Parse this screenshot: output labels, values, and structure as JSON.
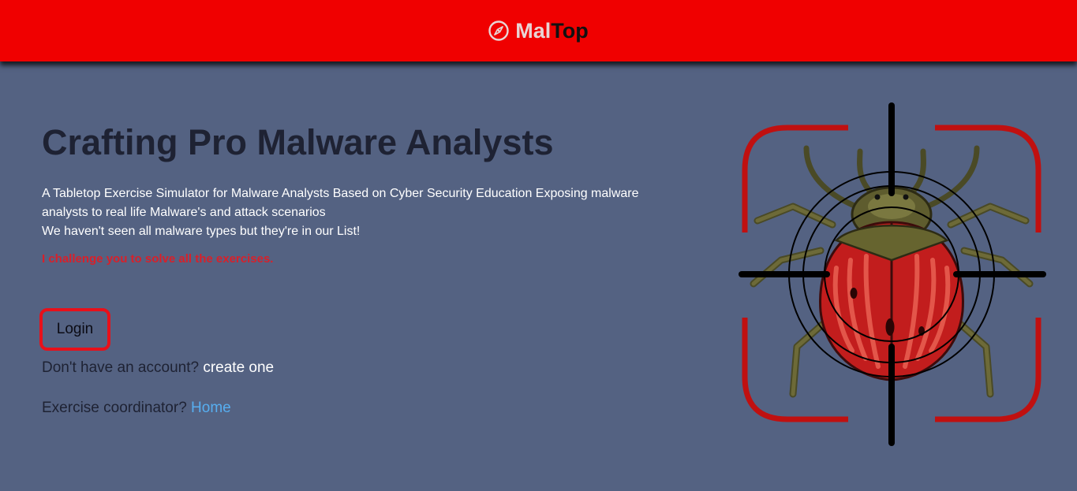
{
  "navbar": {
    "brand_part1": "Mal",
    "brand_part2": "Top",
    "brand_icon": "compass-icon",
    "background": "#f00000"
  },
  "hero": {
    "title": "Crafting Pro Malware Analysts",
    "description_line1": "A Tabletop Exercise Simulator for Malware Analysts Based on Cyber Security Education Exposing malware analysts to real life Malware's and attack scenarios",
    "description_line2": "We haven't seen all malware types but they're in our List!",
    "challenge": "I challenge you to solve all the exercises."
  },
  "actions": {
    "login_label": "Login",
    "signup_prompt": "Don't have an account?",
    "signup_link": "create one",
    "coordinator_prompt": "Exercise coordinator?",
    "coordinator_link": "Home"
  },
  "illustration": {
    "icon": "bug-target-icon"
  },
  "colors": {
    "page_background": "#546282",
    "accent_red": "#f00000",
    "link_blue": "#57aef0"
  }
}
